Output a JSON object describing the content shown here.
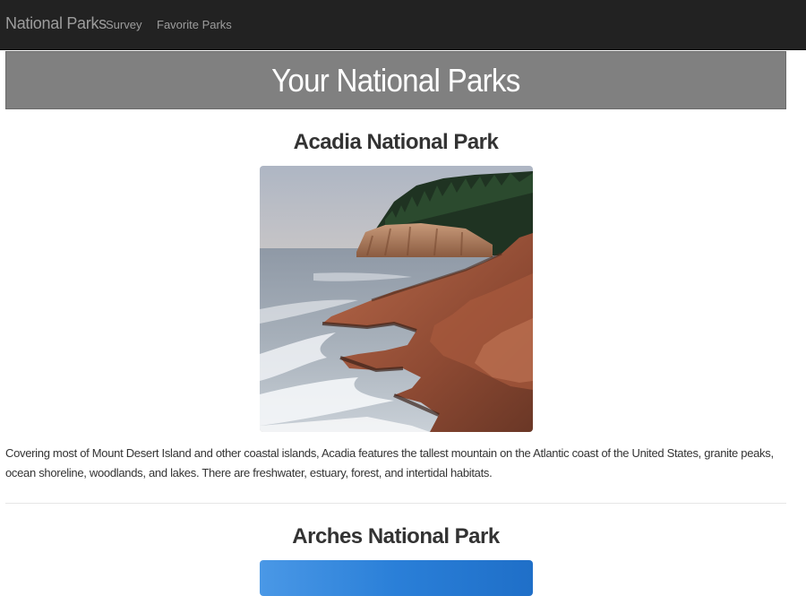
{
  "navbar": {
    "brand": "National Parks",
    "links": [
      "Survey",
      "Favorite Parks"
    ]
  },
  "banner": {
    "title": "Your National Parks"
  },
  "parks": [
    {
      "name": "Acadia National Park",
      "description": "Covering most of Mount Desert Island and other coastal islands, Acadia features the tallest mountain on the Atlantic coast of the United States, granite peaks, ocean shoreline, woodlands, and lakes. There are freshwater, estuary, forest, and intertidal habitats."
    },
    {
      "name": "Arches National Park"
    }
  ],
  "colors": {
    "navbar_bg": "#222222",
    "nav_text": "#9d9d9d",
    "banner_bg": "#808080",
    "banner_text": "#ffffff",
    "text": "#333333"
  }
}
